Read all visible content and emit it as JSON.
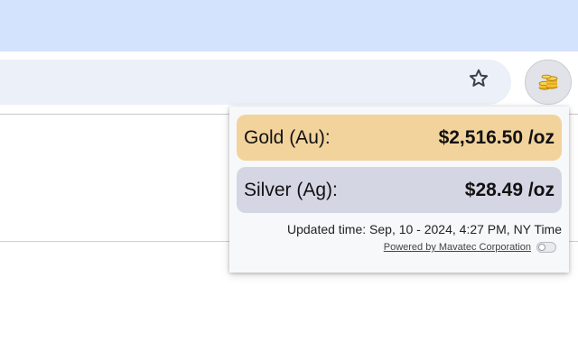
{
  "browser": {
    "icons": {
      "bookmark": "star-outline-icon",
      "extension": "gold-coins-icon"
    },
    "colors": {
      "tabstrip": "#d3e3fd",
      "omnibox": "#ebf0f9"
    }
  },
  "popup": {
    "gold": {
      "label": "Gold (Au):",
      "price": "$2,516.50 /oz",
      "color": "#f2d39c"
    },
    "silver": {
      "label": "Silver (Ag):",
      "price": "$28.49 /oz",
      "color": "#d5d6e4"
    },
    "updated_text": "Updated time: Sep, 10 - 2024, 4:27 PM, NY Time",
    "powered_by": "Powered by Mavatec Corporation",
    "toggle_on": false
  }
}
